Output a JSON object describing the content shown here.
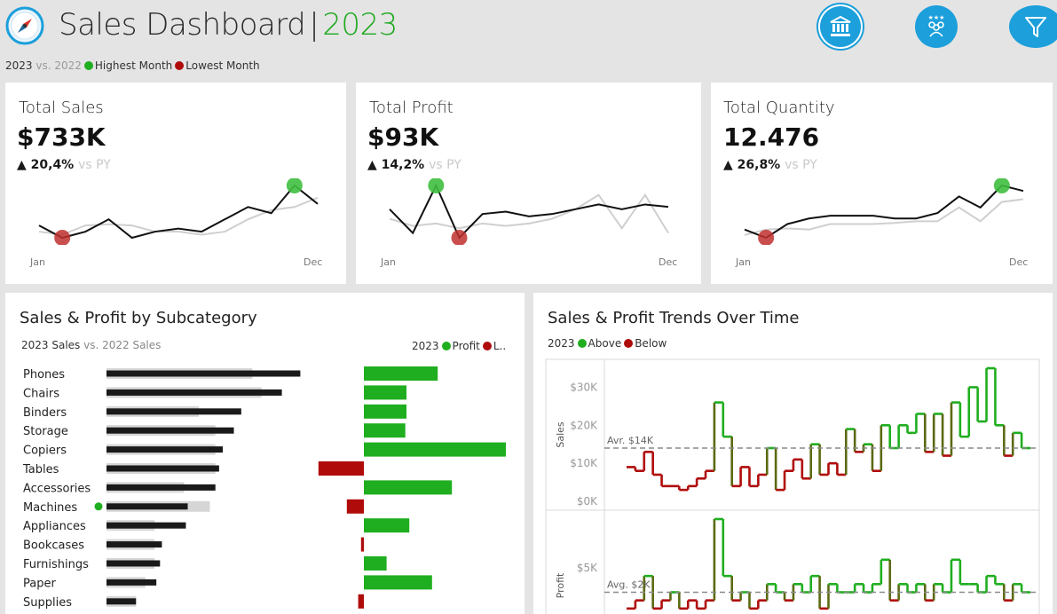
{
  "header": {
    "title": "Sales Dashboard",
    "separator": "|",
    "year": "2023",
    "compass_icon": "compass-icon",
    "buttons": [
      {
        "name": "bank-icon"
      },
      {
        "name": "customers-icon"
      },
      {
        "name": "filter-icon"
      }
    ]
  },
  "legend_bar": {
    "current": "2023",
    "vs": "vs. 2022",
    "highest": "Highest Month",
    "lowest": "Lowest Month"
  },
  "colors": {
    "accent": "#1c9fdb",
    "green": "#1fae1f",
    "red": "#b00b0b"
  },
  "kpis": [
    {
      "title": "Total Sales",
      "value": "$733K",
      "change": "▲ 20,4%",
      "vs": "vs PY",
      "start": "Jan",
      "end": "Dec",
      "cy": [
        4,
        2,
        3,
        5,
        2,
        3,
        3.5,
        3,
        5,
        7,
        6,
        10.5,
        7.5
      ],
      "py": [
        3,
        2.5,
        4,
        4.2,
        4,
        3,
        3,
        2.5,
        3,
        5,
        6.5,
        7,
        8.5
      ],
      "high": 11,
      "low": 1
    },
    {
      "title": "Total Profit",
      "value": "$93K",
      "change": "▲ 14,2%",
      "vs": "vs PY",
      "start": "Jan",
      "end": "Dec",
      "cy": [
        7,
        2,
        12,
        1,
        6,
        6.5,
        5.5,
        6,
        7,
        8,
        7,
        8,
        7.5
      ],
      "py": [
        5,
        3.5,
        4,
        3,
        4,
        3.5,
        4,
        5,
        7,
        10,
        3,
        10,
        2
      ],
      "high": 2,
      "low": 3
    },
    {
      "title": "Total Quantity",
      "value": "12.476",
      "change": "▲ 26,8%",
      "vs": "vs PY",
      "start": "Jan",
      "end": "Dec",
      "cy": [
        3,
        1.5,
        4,
        5,
        5.5,
        5.5,
        5.5,
        5,
        5,
        6,
        9,
        7,
        11,
        10
      ],
      "py": [
        2,
        3,
        3.2,
        3,
        4,
        4,
        4,
        4.2,
        4.5,
        4.5,
        7,
        4.5,
        8,
        8.5
      ],
      "high": 12,
      "low": 1
    }
  ],
  "subcategory": {
    "title": "Sales & Profit by Subcategory",
    "sales_legend": {
      "current": "2023 Sales",
      "vs": "vs. 2022 Sales"
    },
    "profit_legend": {
      "current": "2023",
      "profit": "Profit",
      "loss": "L.."
    },
    "chart_data": {
      "type": "bar",
      "categories": [
        "Phones",
        "Chairs",
        "Binders",
        "Storage",
        "Copiers",
        "Tables",
        "Accessories",
        "Machines",
        "Appliances",
        "Bookcases",
        "Furnishings",
        "Paper",
        "Supplies"
      ],
      "series": [
        {
          "name": "2023 Sales",
          "values": [
            105,
            95,
            73,
            69,
            63,
            61,
            59,
            44,
            43,
            30,
            29,
            27,
            16
          ]
        },
        {
          "name": "2022 Sales",
          "values": [
            79,
            84,
            50,
            59,
            59,
            59,
            42,
            56,
            26,
            26,
            26,
            21,
            16
          ]
        },
        {
          "name": "Profit",
          "values": [
            13,
            7.5,
            7.5,
            7.3,
            25,
            -8,
            15.5,
            -3,
            8,
            -0.5,
            4,
            12,
            -1
          ]
        }
      ],
      "markers": {
        "Machines": "green"
      }
    }
  },
  "trends": {
    "title": "Sales & Profit Trends Over Time",
    "legend": {
      "current": "2023",
      "above": "Above",
      "below": "Below"
    },
    "chart_data": [
      {
        "type": "line",
        "ylabel": "Sales",
        "ylim": [
          0,
          35
        ],
        "ticks": [
          "$30K",
          "$20K",
          "$10K",
          "$0K"
        ],
        "tick_values": [
          30,
          20,
          10,
          0
        ],
        "avg_label": "Avr. $14K",
        "avg": 14,
        "values": [
          9,
          8,
          13,
          7,
          4,
          4,
          3,
          4,
          6,
          8,
          26,
          17,
          4,
          9,
          4,
          7,
          14,
          3,
          8,
          11,
          6,
          15,
          7,
          10,
          7,
          19,
          13,
          15,
          8,
          20,
          14,
          20,
          18,
          23,
          13,
          23,
          12,
          26,
          17,
          30,
          21,
          35,
          20,
          12,
          18,
          14
        ]
      },
      {
        "type": "line",
        "ylabel": "Profit",
        "ylim": [
          -1,
          11
        ],
        "ticks": [
          "$5K"
        ],
        "tick_values": [
          5
        ],
        "avg_label": "Avg. $2K",
        "avg": 2,
        "values": [
          0,
          1,
          4,
          0,
          1,
          2,
          0,
          1,
          0,
          1,
          11,
          4,
          1,
          2,
          0,
          1,
          3,
          2,
          1,
          3,
          2,
          4,
          0,
          3,
          2,
          2,
          3,
          2,
          3,
          6,
          1,
          3,
          2,
          3,
          1,
          3,
          2,
          6,
          3,
          3,
          2,
          4,
          3,
          1,
          3,
          2
        ]
      }
    ]
  }
}
